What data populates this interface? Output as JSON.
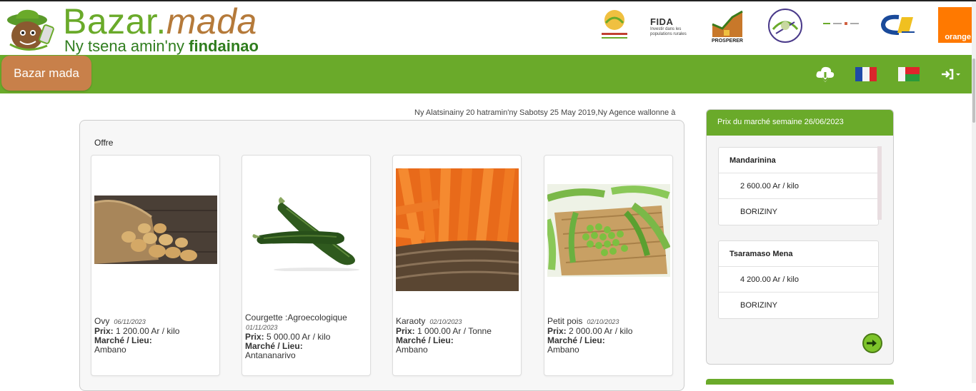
{
  "header": {
    "brand_part1": "Bazar.",
    "brand_part2": "mada",
    "tagline_part1": "Ny tsena amin'ny ",
    "tagline_part2": "findainao",
    "partners": {
      "fida_label": "FIDA",
      "fida_sub": "Investir dans les populations rurales",
      "prosperer_label": "PROSPERER",
      "orange_label": "orange"
    }
  },
  "navbar": {
    "brand_button": "Bazar mada",
    "icons": [
      "cloud-download-icon",
      "flag-france-icon",
      "flag-madagascar-icon",
      "sign-in-icon"
    ]
  },
  "marquee": {
    "text": "Ny Alatsinainy 20 hatramin'ny Sabotsy 25 May 2019,Ny Agence wallonne à"
  },
  "offers": {
    "title": "Offre",
    "price_label": "Prix:",
    "market_label": "Marché / Lieu:",
    "items": [
      {
        "name": "Ovy",
        "date": "06/11/2023",
        "price": "1 200.00 Ar / kilo",
        "place": "Ambano"
      },
      {
        "name": "Courgette :Agroecologique",
        "date": "01/11/2023",
        "price": "5 000.00 Ar / kilo",
        "place": "Antananarivo"
      },
      {
        "name": "Karaoty",
        "date": "02/10/2023",
        "price": "1 000.00 Ar / Tonne",
        "place": "Ambano"
      },
      {
        "name": "Petit pois",
        "date": "02/10/2023",
        "price": "2 000.00 Ar / kilo",
        "place": "Ambano"
      }
    ]
  },
  "prices": {
    "title": "Prix du marché semaine 26/06/2023",
    "items": [
      {
        "name": "Mandarinina",
        "price": "2 600.00 Ar / kilo",
        "market": "BORIZINY"
      },
      {
        "name": "Tsaramaso Mena",
        "price": "4 200.00 Ar / kilo",
        "market": "BORIZINY"
      }
    ]
  },
  "colors": {
    "brand_green": "#6aaa2a",
    "brand_brown": "#c8804a"
  }
}
